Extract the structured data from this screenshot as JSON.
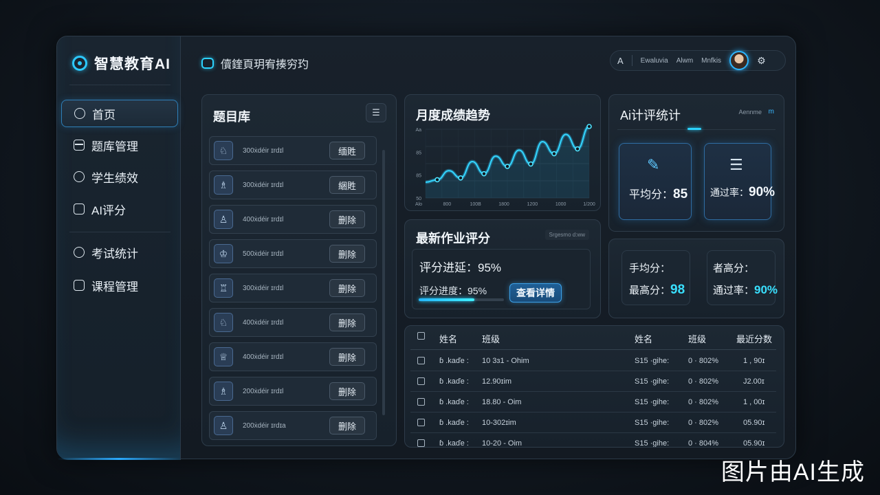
{
  "app": {
    "logo": "智慧教育AI",
    "page_title": "儥鍷頁玥宥揍穷玓"
  },
  "sidebar": {
    "items": [
      {
        "label": "首页",
        "icon": "smile-icon"
      },
      {
        "label": "题库管理",
        "icon": "tab-icon"
      },
      {
        "label": "学生绩效",
        "icon": "bubble-icon"
      },
      {
        "label": "AI评分",
        "icon": "doc-icon"
      },
      {
        "label": "考试统计",
        "icon": "info-icon"
      },
      {
        "label": "课程管理",
        "icon": "book-icon"
      }
    ]
  },
  "topbar": {
    "items": [
      "Ewaluvia",
      "Alwm",
      "Mnfkis"
    ],
    "left_icon": "A",
    "right_icon": "settings-icon"
  },
  "question_bank": {
    "title": "题目库",
    "rows": [
      {
        "text": "300ẋdéir ɪrdɪl",
        "btn": "缅貹"
      },
      {
        "text": "300ẋdéir ɪrdɪl",
        "btn": "綑貹"
      },
      {
        "text": "400ẋdéir ɪrdɪl",
        "btn": "删除"
      },
      {
        "text": "500ẋdéir ɪrdɪl",
        "btn": "删除"
      },
      {
        "text": "300ẋdéir ɪrdɪl",
        "btn": "删除"
      },
      {
        "text": "400ẋdéir ɪrdɪl",
        "btn": "删除"
      },
      {
        "text": "400ẋdéir ɪrdɪl",
        "btn": "删除"
      },
      {
        "text": "200ẋdéir ɪrdɪl",
        "btn": "删除"
      },
      {
        "text": "200ẋdéir ɪrdɪa",
        "btn": "删除"
      }
    ]
  },
  "trend": {
    "title": "月度成绩趋势",
    "y_ticks": [
      "Aa",
      "85",
      "85",
      "50"
    ],
    "x_ticks": [
      "Alo",
      "800",
      "100B",
      "1800",
      "1200",
      "1000",
      "1/200"
    ]
  },
  "chart_data": {
    "type": "line",
    "title": "月度成绩趋势",
    "series": [
      {
        "values": [
          0.08,
          0.12,
          0.27,
          0.15,
          0.42,
          0.22,
          0.51,
          0.34,
          0.61,
          0.38,
          0.75,
          0.55,
          0.87,
          0.63,
          1.0
        ]
      }
    ],
    "grid": true
  },
  "latest_grading": {
    "title": "最新作业评分",
    "tag": "Srgesmo d:ww",
    "line1_label": "评分进延：",
    "line1_value": "95%",
    "line2_label": "评分进度：",
    "line2_value": "95%",
    "progress": 0.65,
    "button": "查看详情"
  },
  "ai_stats": {
    "title": "Ai计评统计",
    "header_text": "Aennme",
    "header_icon": "m",
    "card1": {
      "label": "平均分：",
      "value": "85"
    },
    "card2": {
      "label": "通过率：",
      "value": "90%"
    }
  },
  "summary": {
    "left_top": "手均分：",
    "left_bottom_label": "最高分：",
    "left_bottom_value": "98",
    "right_top": "者高分：",
    "right_bottom_label": "通过率：",
    "right_bottom_value": "90%"
  },
  "table": {
    "headers": [
      "姓名",
      "班级",
      "姓名",
      "班级",
      "最近分数"
    ],
    "rows": [
      [
        "ɓ .kaďe :",
        "10 3ɜ1 - Ohim",
        "S15 ·gihe:",
        "0 · 802%",
        "1 , 90ɪ"
      ],
      [
        "ɓ .kaďe :",
        "12.90ɪim",
        "S15 ·gihe:",
        "0 · 802%",
        "J2.00ɪ"
      ],
      [
        "ɓ .kaďe :",
        "18.80 - Oim",
        "S15 ·gihe:",
        "0 · 802%",
        "1 , 00ɪ"
      ],
      [
        "ɓ .kaďe :",
        "10-302ɪim",
        "S15 ·gihe:",
        "0 · 802%",
        "05.90ɪ"
      ],
      [
        "ɓ .kaďe :",
        "10-20 - Oim",
        "S15 ·gihe:",
        "0 · 804%",
        "05.90ɪ"
      ]
    ]
  },
  "watermark": "图片由AI生成",
  "colors": {
    "accent": "#2cc9ff",
    "bg": "#111820",
    "panel": "#1d2833"
  }
}
